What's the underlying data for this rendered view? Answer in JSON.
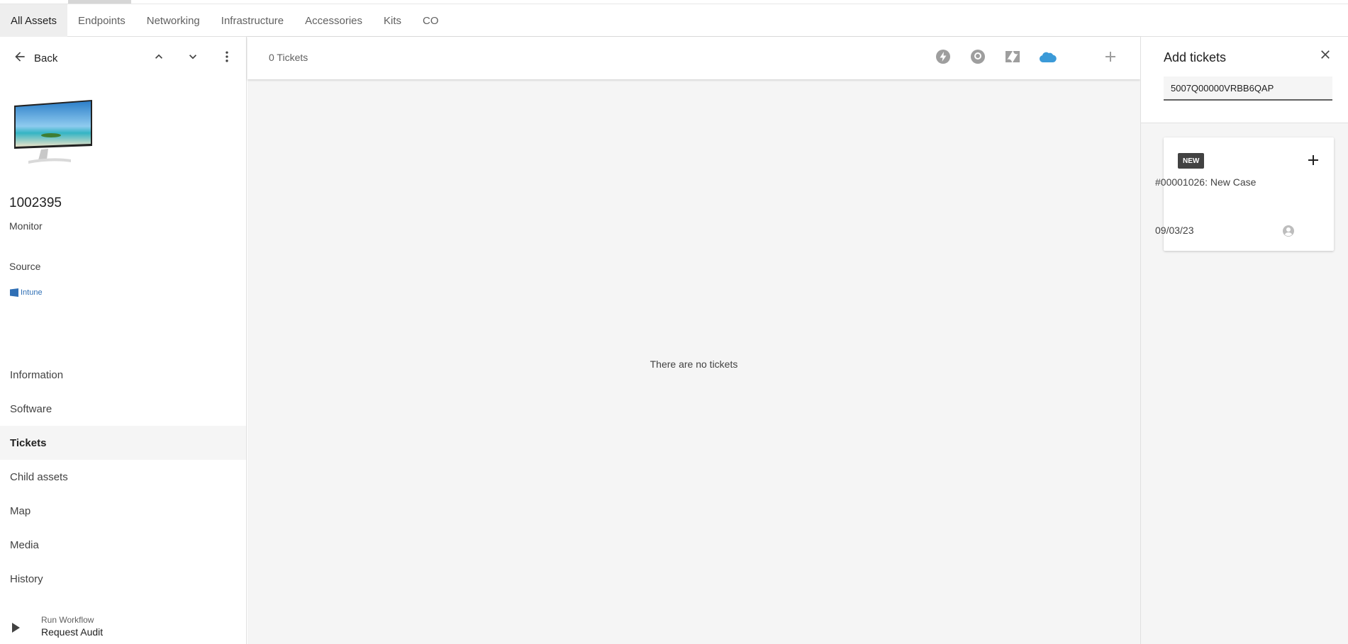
{
  "top_tabs": [
    {
      "label": "All Assets",
      "active": true
    },
    {
      "label": "Endpoints"
    },
    {
      "label": "Networking"
    },
    {
      "label": "Infrastructure"
    },
    {
      "label": "Accessories"
    },
    {
      "label": "Kits"
    },
    {
      "label": "CO"
    }
  ],
  "sidebar": {
    "back_label": "Back",
    "asset_id": "1002395",
    "asset_type": "Monitor",
    "source_label": "Source",
    "source_value": "Intune",
    "nav": [
      {
        "label": "Information"
      },
      {
        "label": "Software"
      },
      {
        "label": "Tickets",
        "active": true
      },
      {
        "label": "Child assets"
      },
      {
        "label": "Map"
      },
      {
        "label": "Media"
      },
      {
        "label": "History"
      }
    ],
    "workflow": {
      "caption": "Run Workflow",
      "name": "Request Audit"
    }
  },
  "main": {
    "ticket_count": "0 Tickets",
    "empty_message": "There are no tickets",
    "integrations": [
      "lightning-icon",
      "user-circle-icon",
      "zendesk-icon",
      "salesforce-cloud-icon"
    ]
  },
  "drawer": {
    "title": "Add tickets",
    "search_value": "5007Q00000VRBB6QAP",
    "results": [
      {
        "badge": "NEW",
        "title": "#00001026: New Case",
        "date": "09/03/23"
      }
    ]
  },
  "colors": {
    "salesforce": "#3b9ad8",
    "link": "#2f6fb5",
    "badge": "#424242"
  }
}
